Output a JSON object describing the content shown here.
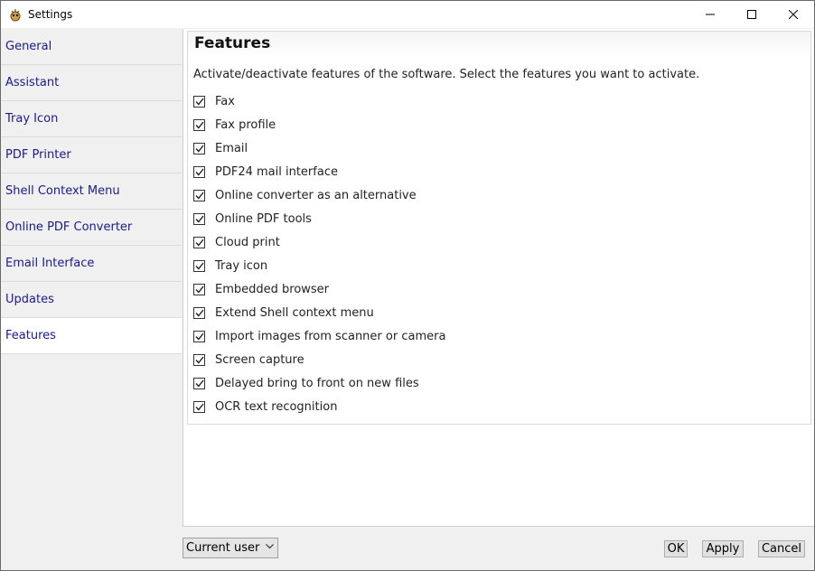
{
  "window": {
    "title": "Settings"
  },
  "sidebar": {
    "items": [
      {
        "label": "General"
      },
      {
        "label": "Assistant"
      },
      {
        "label": "Tray Icon"
      },
      {
        "label": "PDF Printer"
      },
      {
        "label": "Shell Context Menu"
      },
      {
        "label": "Online PDF Converter"
      },
      {
        "label": "Email Interface"
      },
      {
        "label": "Updates"
      },
      {
        "label": "Features",
        "active": true
      }
    ]
  },
  "panel": {
    "title": "Features",
    "description": "Activate/deactivate features of the software. Select the features you want to activate.",
    "features": [
      {
        "label": "Fax",
        "checked": true
      },
      {
        "label": "Fax profile",
        "checked": true
      },
      {
        "label": "Email",
        "checked": true
      },
      {
        "label": "PDF24 mail interface",
        "checked": true
      },
      {
        "label": "Online converter as an alternative",
        "checked": true
      },
      {
        "label": "Online PDF tools",
        "checked": true
      },
      {
        "label": "Cloud print",
        "checked": true
      },
      {
        "label": "Tray icon",
        "checked": true
      },
      {
        "label": "Embedded browser",
        "checked": true
      },
      {
        "label": "Extend Shell context menu",
        "checked": true
      },
      {
        "label": "Import images from scanner or camera",
        "checked": true
      },
      {
        "label": "Screen capture",
        "checked": true
      },
      {
        "label": "Delayed bring to front on new files",
        "checked": true
      },
      {
        "label": "OCR text recognition",
        "checked": true
      }
    ]
  },
  "footer": {
    "scope_select": "Current user",
    "ok_label": "OK",
    "apply_label": "Apply",
    "cancel_label": "Cancel"
  }
}
